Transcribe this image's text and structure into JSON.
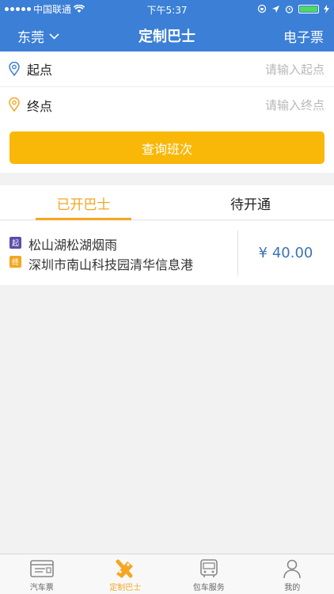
{
  "status_bar": {
    "carrier": "中国联通",
    "time": "下午5:37"
  },
  "navbar": {
    "city": "东莞",
    "title": "定制巴士",
    "right_label": "电子票"
  },
  "form": {
    "start_label": "起点",
    "start_placeholder": "请输入起点",
    "end_label": "终点",
    "end_placeholder": "请输入终点",
    "query_button": "查询班次"
  },
  "tabs": [
    {
      "label": "已开巴士",
      "active": true
    },
    {
      "label": "待开通",
      "active": false
    }
  ],
  "routes": [
    {
      "start_badge": "起",
      "start": "松山湖松湖烟雨",
      "end_badge": "终",
      "end": "深圳市南山科技园清华信息港",
      "price": "¥ 40.00"
    }
  ],
  "tabbar": {
    "items": [
      {
        "label": "汽车票",
        "icon": "ticket-icon",
        "active": false
      },
      {
        "label": "定制巴士",
        "icon": "custom-bus-icon",
        "active": true
      },
      {
        "label": "包车服务",
        "icon": "bus-icon",
        "active": false
      },
      {
        "label": "我的",
        "icon": "profile-icon",
        "active": false
      }
    ]
  },
  "colors": {
    "header": "#3b7fd6",
    "accent": "#f9b707",
    "price": "#3b73b9",
    "start_badge": "#5b4ea8",
    "end_badge": "#f5a623"
  }
}
